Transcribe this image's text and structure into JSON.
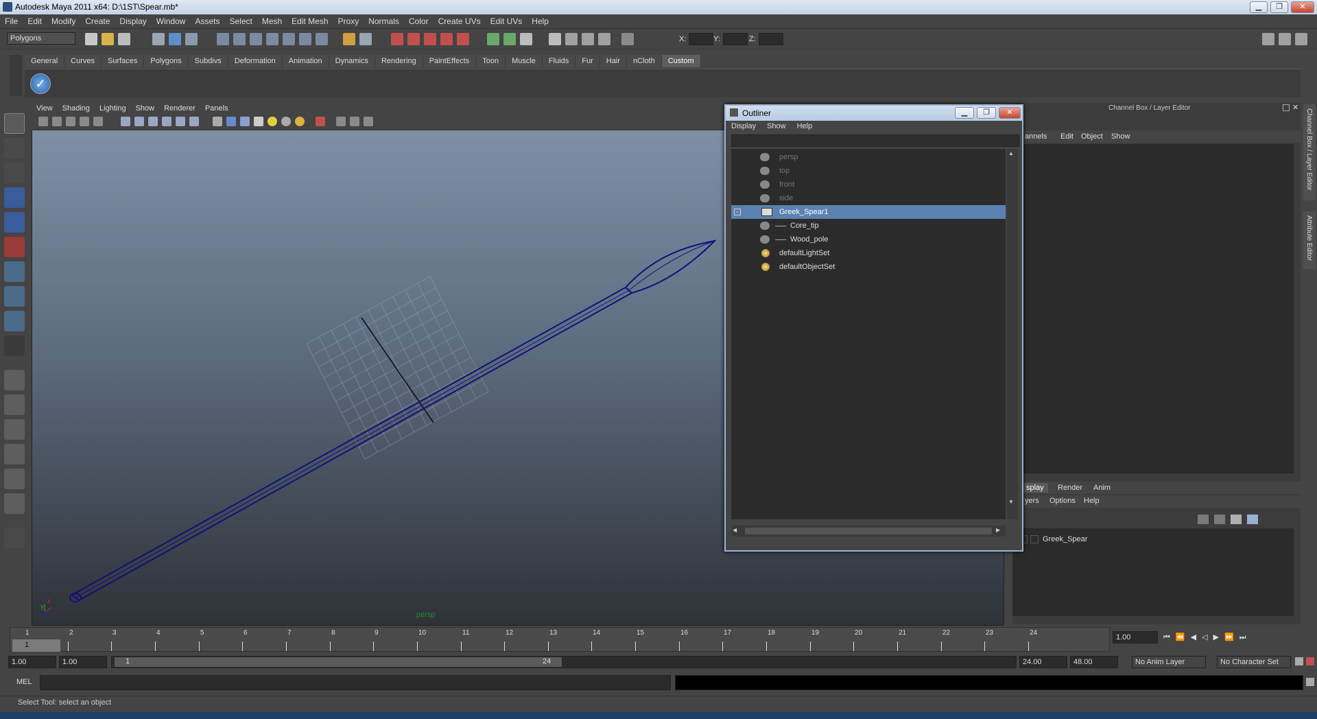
{
  "window": {
    "title": "Autodesk Maya 2011 x64: D:\\1ST\\Spear.mb*"
  },
  "menubar": [
    "File",
    "Edit",
    "Modify",
    "Create",
    "Display",
    "Window",
    "Assets",
    "Select",
    "Mesh",
    "Edit Mesh",
    "Proxy",
    "Normals",
    "Color",
    "Create UVs",
    "Edit UVs",
    "Help"
  ],
  "statusline": {
    "mode": "Polygons",
    "x_label": "X:",
    "y_label": "Y:",
    "z_label": "Z:"
  },
  "shelf_tabs": [
    "General",
    "Curves",
    "Surfaces",
    "Polygons",
    "Subdivs",
    "Deformation",
    "Animation",
    "Dynamics",
    "Rendering",
    "PaintEffects",
    "Toon",
    "Muscle",
    "Fluids",
    "Fur",
    "Hair",
    "nCloth",
    "Custom"
  ],
  "shelf_active": "Custom",
  "viewport": {
    "menu": [
      "View",
      "Shading",
      "Lighting",
      "Show",
      "Renderer",
      "Panels"
    ],
    "camera": "persp",
    "axis_x": "x",
    "axis_y": "y"
  },
  "outliner": {
    "title": "Outliner",
    "menu": [
      "Display",
      "Show",
      "Help"
    ],
    "items": [
      {
        "label": "persp",
        "dim": true,
        "indent": 0
      },
      {
        "label": "top",
        "dim": true,
        "indent": 0
      },
      {
        "label": "front",
        "dim": true,
        "indent": 0
      },
      {
        "label": "side",
        "dim": true,
        "indent": 0
      },
      {
        "label": "Greek_Spear1",
        "dim": false,
        "indent": 0,
        "selected": true
      },
      {
        "label": "Core_tip",
        "dim": false,
        "indent": 1
      },
      {
        "label": "Wood_pole",
        "dim": false,
        "indent": 1
      },
      {
        "label": "defaultLightSet",
        "dim": false,
        "indent": 0
      },
      {
        "label": "defaultObjectSet",
        "dim": false,
        "indent": 0
      }
    ]
  },
  "channel_box": {
    "title": "Channel Box / Layer Editor",
    "menu": [
      "annels",
      "Edit",
      "Object",
      "Show"
    ],
    "side_tabs": [
      "Channel Box / Layer Editor",
      "Attribute Editor"
    ],
    "layer_tabs": [
      "splay",
      "Render",
      "Anim"
    ],
    "layer_menu": [
      "yers",
      "Options",
      "Help"
    ],
    "layer_name": "Greek_Spear"
  },
  "timeline": {
    "ticks": [
      "1",
      "2",
      "3",
      "4",
      "5",
      "6",
      "7",
      "8",
      "9",
      "10",
      "11",
      "12",
      "13",
      "14",
      "15",
      "16",
      "17",
      "18",
      "19",
      "20",
      "21",
      "22",
      "23",
      "24"
    ],
    "current_frame": "1",
    "current_field": "1.00"
  },
  "range": {
    "start": "1.00",
    "start2": "1.00",
    "slider_start": "1",
    "slider_end": "24",
    "end": "24.00",
    "end2": "48.00",
    "anim_layer": "No Anim Layer",
    "char_set": "No Character Set"
  },
  "cmdline": {
    "label": "MEL"
  },
  "helpline": {
    "text": "Select Tool: select an object"
  }
}
